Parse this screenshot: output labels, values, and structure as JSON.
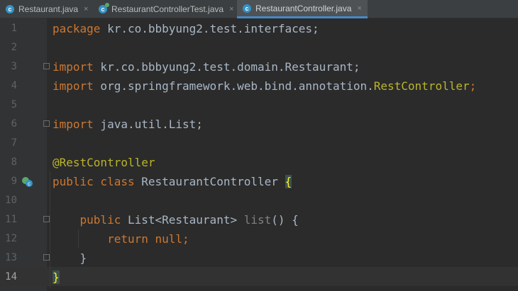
{
  "tabs": [
    {
      "label": "Restaurant.java",
      "active": false,
      "icon": "class-icon",
      "close": "×"
    },
    {
      "label": "RestaurantControllerTest.java",
      "active": false,
      "icon": "test-class-icon",
      "close": "×"
    },
    {
      "label": "RestaurantController.java",
      "active": true,
      "icon": "class-icon",
      "close": "×"
    }
  ],
  "icon_letter": "c",
  "line_numbers": [
    "1",
    "2",
    "3",
    "4",
    "5",
    "6",
    "7",
    "8",
    "9",
    "10",
    "11",
    "12",
    "13",
    "14"
  ],
  "current_line": 14,
  "code": {
    "l1_kw": "package",
    "l1_rest": " kr.co.bbbyung2.test.interfaces;",
    "l3_kw": "import",
    "l3_rest": " kr.co.bbbyung2.test.domain.Restaurant;",
    "l4_kw": "import",
    "l4_pkg": " org.springframework.web.bind.annotation.",
    "l4_cls": "RestController",
    "l4_semi": ";",
    "l6_kw": "import",
    "l6_rest": " java.util.List;",
    "l8_ann": "@RestController",
    "l9_kw": "public class",
    "l9_name": " RestaurantController ",
    "l9_brace": "{",
    "l11_kw": "public",
    "l11_type": " List<Restaurant> ",
    "l11_method": "list",
    "l11_rest": "() {",
    "l12_kw": "return",
    "l12_null": " null;",
    "l13_brace": "}",
    "l14_brace": "}"
  }
}
